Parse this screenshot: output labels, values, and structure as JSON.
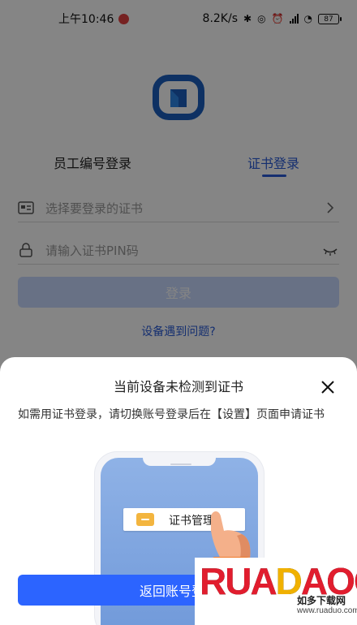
{
  "status_bar": {
    "time": "上午10:46",
    "speed": "8.2K/s",
    "battery": "87",
    "icons": [
      "weibo-icon",
      "bluetooth-icon",
      "hd-icon",
      "alarm-icon",
      "signal-icon",
      "wifi-icon",
      "battery-icon"
    ]
  },
  "login": {
    "tabs": [
      {
        "label": "员工编号登录",
        "active": false
      },
      {
        "label": "证书登录",
        "active": true
      }
    ],
    "cert_select_placeholder": "选择要登录的证书",
    "pin_placeholder": "请输入证书PIN码",
    "login_button": "登录",
    "problem_link": "设备遇到问题?"
  },
  "sheet": {
    "title": "当前设备未检测到证书",
    "description": "如需用证书登录，请切换账号登录后在【设置】页面申请证书",
    "illustration_label": "证书管理",
    "back_button": "返回账号登录"
  },
  "watermark": {
    "logo": "RUADAOO",
    "subtitle": "如多下载网",
    "url": "www.ruaduo.com"
  },
  "colors": {
    "accent": "#2a5bd7",
    "button_primary": "#2c64ff",
    "button_disabled": "#c7d8ff"
  }
}
